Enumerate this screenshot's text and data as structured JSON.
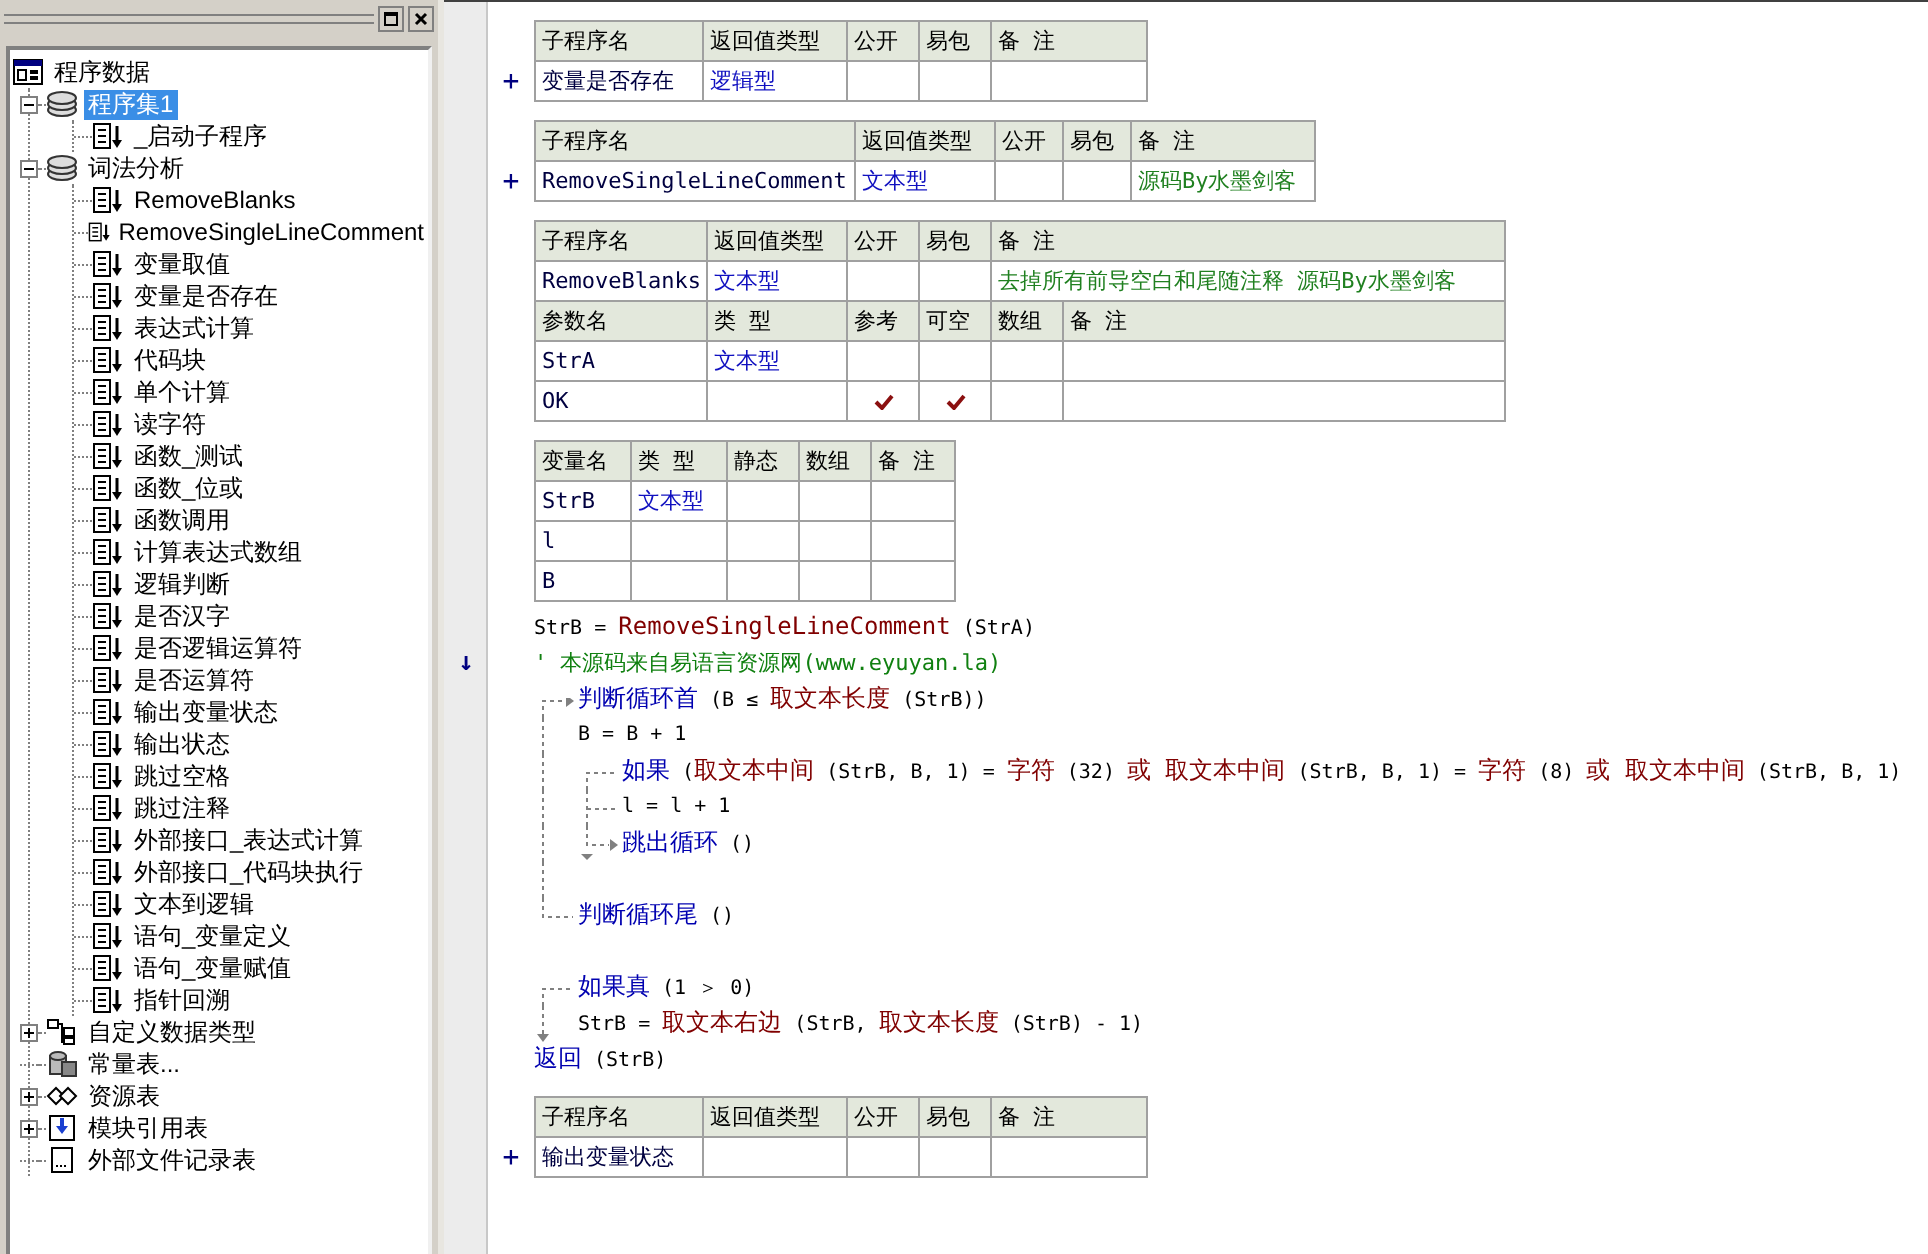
{
  "panel": {
    "tree": [
      {
        "label": "程序数据",
        "kind": "root",
        "selected": false,
        "children": [
          {
            "label": "程序集1",
            "kind": "assembly",
            "expanded": true,
            "selected": true,
            "children": [
              {
                "label": "_启动子程序",
                "kind": "sub",
                "selected": false
              }
            ]
          },
          {
            "label": "词法分析",
            "kind": "assembly",
            "expanded": true,
            "selected": false,
            "children": [
              {
                "label": "RemoveBlanks",
                "kind": "sub",
                "selected": false
              },
              {
                "label": "RemoveSingleLineComment",
                "kind": "sub",
                "selected": false
              },
              {
                "label": "变量取值",
                "kind": "sub",
                "selected": false
              },
              {
                "label": "变量是否存在",
                "kind": "sub",
                "selected": false
              },
              {
                "label": "表达式计算",
                "kind": "sub",
                "selected": false
              },
              {
                "label": "代码块",
                "kind": "sub",
                "selected": false
              },
              {
                "label": "单个计算",
                "kind": "sub",
                "selected": false
              },
              {
                "label": "读字符",
                "kind": "sub",
                "selected": false
              },
              {
                "label": "函数_测试",
                "kind": "sub",
                "selected": false
              },
              {
                "label": "函数_位或",
                "kind": "sub",
                "selected": false
              },
              {
                "label": "函数调用",
                "kind": "sub",
                "selected": false
              },
              {
                "label": "计算表达式数组",
                "kind": "sub",
                "selected": false
              },
              {
                "label": "逻辑判断",
                "kind": "sub",
                "selected": false
              },
              {
                "label": "是否汉字",
                "kind": "sub",
                "selected": false
              },
              {
                "label": "是否逻辑运算符",
                "kind": "sub",
                "selected": false
              },
              {
                "label": "是否运算符",
                "kind": "sub",
                "selected": false
              },
              {
                "label": "输出变量状态",
                "kind": "sub",
                "selected": false
              },
              {
                "label": "输出状态",
                "kind": "sub",
                "selected": false
              },
              {
                "label": "跳过空格",
                "kind": "sub",
                "selected": false
              },
              {
                "label": "跳过注释",
                "kind": "sub",
                "selected": false
              },
              {
                "label": "外部接口_表达式计算",
                "kind": "sub",
                "selected": false
              },
              {
                "label": "外部接口_代码块执行",
                "kind": "sub",
                "selected": false
              },
              {
                "label": "文本到逻辑",
                "kind": "sub",
                "selected": false
              },
              {
                "label": "语句_变量定义",
                "kind": "sub",
                "selected": false
              },
              {
                "label": "语句_变量赋值",
                "kind": "sub",
                "selected": false
              },
              {
                "label": "指针回溯",
                "kind": "sub",
                "selected": false
              }
            ]
          },
          {
            "label": "自定义数据类型",
            "kind": "datatype",
            "expanded": false,
            "selected": false
          },
          {
            "label": "常量表...",
            "kind": "const",
            "selected": false
          },
          {
            "label": "资源表",
            "kind": "resource",
            "expanded": false,
            "selected": false
          },
          {
            "label": "模块引用表",
            "kind": "module",
            "expanded": false,
            "selected": false
          },
          {
            "label": "外部文件记录表",
            "kind": "file",
            "selected": false
          }
        ]
      }
    ]
  },
  "editor": {
    "blocks": [
      {
        "kind": "table",
        "mark": "+",
        "rows": [
          {
            "kind": "header",
            "cells": [
              {
                "text": "子程序名"
              },
              {
                "text": "返回值类型"
              },
              {
                "text": "公开"
              },
              {
                "text": "易包"
              },
              {
                "text": "备 注"
              }
            ]
          },
          {
            "kind": "data",
            "cells": [
              {
                "text": "变量是否存在",
                "kind": "name"
              },
              {
                "text": "逻辑型",
                "kind": "type"
              },
              {
                "kind": "plain"
              },
              {
                "kind": "plain"
              },
              {
                "kind": "plain"
              }
            ]
          }
        ]
      },
      {
        "kind": "table",
        "mark": "+",
        "rows": [
          {
            "kind": "header",
            "cells": [
              {
                "text": "子程序名"
              },
              {
                "text": "返回值类型"
              },
              {
                "text": "公开"
              },
              {
                "text": "易包"
              },
              {
                "text": "备 注"
              }
            ]
          },
          {
            "kind": "data",
            "cells": [
              {
                "text": "RemoveSingleLineComment",
                "kind": "name"
              },
              {
                "text": "文本型",
                "kind": "type"
              },
              {
                "kind": "plain"
              },
              {
                "kind": "plain"
              },
              {
                "text": "源码By水墨剑客",
                "kind": "note"
              }
            ]
          }
        ]
      },
      {
        "kind": "table",
        "rows": [
          {
            "kind": "header",
            "cells": [
              {
                "text": "子程序名"
              },
              {
                "text": "返回值类型"
              },
              {
                "text": "公开"
              },
              {
                "text": "易包"
              },
              {
                "text": "备 注"
              }
            ]
          },
          {
            "kind": "data",
            "cells": [
              {
                "text": "RemoveBlanks",
                "kind": "name"
              },
              {
                "text": "文本型",
                "kind": "type"
              },
              {
                "kind": "plain"
              },
              {
                "kind": "plain"
              },
              {
                "text": "去掉所有前导空白和尾随注释 源码By水墨剑客",
                "kind": "note"
              }
            ]
          },
          {
            "kind": "header",
            "cells": [
              {
                "text": "参数名"
              },
              {
                "text": "类 型"
              },
              {
                "text": "参考"
              },
              {
                "text": "可空"
              },
              {
                "text": "数组"
              },
              {
                "text": "备 注"
              }
            ]
          },
          {
            "kind": "data",
            "cells": [
              {
                "text": "StrA",
                "kind": "name"
              },
              {
                "text": "文本型",
                "kind": "type"
              },
              {
                "kind": "check",
                "checked": false
              },
              {
                "kind": "check",
                "checked": false
              },
              {
                "kind": "plain"
              },
              {
                "kind": "plain"
              }
            ]
          },
          {
            "kind": "data",
            "cells": [
              {
                "text": "OK",
                "kind": "name"
              },
              {
                "kind": "plain"
              },
              {
                "kind": "check",
                "checked": true
              },
              {
                "kind": "check",
                "checked": true
              },
              {
                "kind": "plain"
              },
              {
                "kind": "plain"
              }
            ]
          }
        ]
      },
      {
        "kind": "table",
        "rows": [
          {
            "kind": "header",
            "cells": [
              {
                "text": "变量名"
              },
              {
                "text": "类 型"
              },
              {
                "text": "静态"
              },
              {
                "text": "数组"
              },
              {
                "text": "备 注"
              }
            ]
          },
          {
            "kind": "data",
            "cells": [
              {
                "text": "StrB",
                "kind": "name"
              },
              {
                "text": "文本型",
                "kind": "type"
              },
              {
                "kind": "plain"
              },
              {
                "kind": "plain"
              },
              {
                "kind": "plain"
              }
            ]
          },
          {
            "kind": "data",
            "cells": [
              {
                "text": "l",
                "kind": "name"
              },
              {
                "kind": "plain"
              },
              {
                "kind": "plain"
              },
              {
                "kind": "plain"
              },
              {
                "kind": "plain"
              }
            ]
          },
          {
            "kind": "data",
            "cells": [
              {
                "text": "B",
                "kind": "name"
              },
              {
                "kind": "plain"
              },
              {
                "kind": "plain"
              },
              {
                "kind": "plain"
              },
              {
                "kind": "plain"
              }
            ]
          }
        ]
      },
      {
        "kind": "code",
        "lines": [
          {
            "tokens": [
              {
                "kind": "plain",
                "text": "StrB = "
              },
              {
                "kind": "func",
                "text": "RemoveSingleLineComment"
              },
              {
                "kind": "plain",
                "text": " (StrA)"
              }
            ]
          },
          {
            "gutter": "↓",
            "tokens": [
              {
                "kind": "comment",
                "text": "' 本源码来自易语言资源网(www.eyuyan.la)"
              }
            ]
          },
          {
            "guides": [
              {
                "kind": "start_arrow"
              }
            ],
            "tokens": [
              {
                "kind": "cmd",
                "text": "判断循环首"
              },
              {
                "kind": "plain",
                "text": " (B ≤ "
              },
              {
                "kind": "func",
                "text": "取文本长度"
              },
              {
                "kind": "plain",
                "text": " (StrB))"
              }
            ]
          },
          {
            "guides": [
              {
                "kind": "pass"
              }
            ],
            "tokens": [
              {
                "kind": "plain",
                "text": "B = B + 1"
              }
            ]
          },
          {
            "guides": [
              {
                "kind": "pass"
              },
              {
                "kind": "start"
              }
            ],
            "tokens": [
              {
                "kind": "cmd",
                "text": "如果"
              },
              {
                "kind": "plain",
                "text": " ("
              },
              {
                "kind": "func",
                "text": "取文本中间"
              },
              {
                "kind": "plain",
                "text": " (StrB, B, 1) = "
              },
              {
                "kind": "func",
                "text": "字符"
              },
              {
                "kind": "plain",
                "text": " (32) "
              },
              {
                "kind": "func",
                "text": "或 取文本中间"
              },
              {
                "kind": "plain",
                "text": " (StrB, B, 1) = "
              },
              {
                "kind": "func",
                "text": "字符"
              },
              {
                "kind": "plain",
                "text": " (8) "
              },
              {
                "kind": "func",
                "text": "或 取文本中间"
              },
              {
                "kind": "plain",
                "text": " (StrB, B, 1)"
              }
            ]
          },
          {
            "guides": [
              {
                "kind": "pass"
              },
              {
                "kind": "branch"
              }
            ],
            "tokens": [
              {
                "kind": "plain",
                "text": "l = l + 1"
              }
            ]
          },
          {
            "guides": [
              {
                "kind": "pass"
              },
              {
                "kind": "end_arrow"
              }
            ],
            "tokens": [
              {
                "kind": "cmd",
                "text": "跳出循环"
              },
              {
                "kind": "plain",
                "text": " ()"
              }
            ]
          },
          {
            "guides": [
              {
                "kind": "pass"
              }
            ]
          },
          {
            "guides": [
              {
                "kind": "end"
              }
            ],
            "tokens": [
              {
                "kind": "cmd",
                "text": "判断循环尾"
              },
              {
                "kind": "plain",
                "text": " ()"
              }
            ]
          }
        ]
      },
      {
        "kind": "code",
        "lines": [
          {
            "guides": [
              {
                "kind": "start"
              }
            ],
            "tokens": [
              {
                "kind": "cmd",
                "text": "如果真"
              },
              {
                "kind": "plain",
                "text": " (1 ＞ 0)"
              }
            ]
          },
          {
            "guides": [
              {
                "kind": "down"
              }
            ],
            "tokens": [
              {
                "kind": "plain",
                "text": "StrB = "
              },
              {
                "kind": "func",
                "text": "取文本右边"
              },
              {
                "kind": "plain",
                "text": " (StrB, "
              },
              {
                "kind": "func",
                "text": "取文本长度"
              },
              {
                "kind": "plain",
                "text": " (StrB) - 1)"
              }
            ]
          },
          {
            "tokens": [
              {
                "kind": "cmd",
                "text": "返回"
              },
              {
                "kind": "plain",
                "text": " (StrB)"
              }
            ]
          }
        ]
      },
      {
        "kind": "table",
        "mark": "+",
        "rows": [
          {
            "kind": "header",
            "cells": [
              {
                "text": "子程序名"
              },
              {
                "text": "返回值类型"
              },
              {
                "text": "公开"
              },
              {
                "text": "易包"
              },
              {
                "text": "备 注"
              }
            ]
          },
          {
            "kind": "data",
            "cells": [
              {
                "text": "输出变量状态",
                "kind": "name"
              },
              {
                "kind": "plain"
              },
              {
                "kind": "plain"
              },
              {
                "kind": "plain"
              },
              {
                "kind": "plain"
              }
            ]
          }
        ]
      }
    ]
  }
}
